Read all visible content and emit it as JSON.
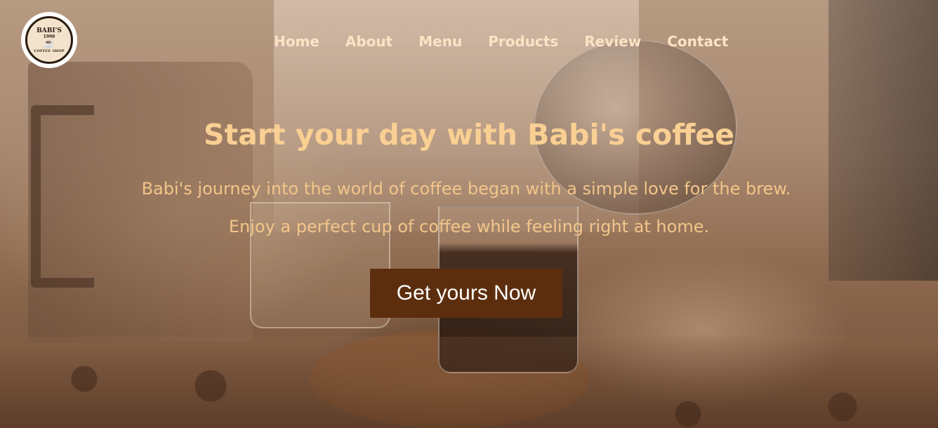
{
  "brand": {
    "logo_name": "BABI'S",
    "logo_year": "1990",
    "logo_shop": "COFFEE SHOP",
    "logo_icon": "coffee-cup-icon"
  },
  "nav": {
    "items": [
      {
        "label": "Home"
      },
      {
        "label": "About"
      },
      {
        "label": "Menu"
      },
      {
        "label": "Products"
      },
      {
        "label": "Review"
      },
      {
        "label": "Contact"
      }
    ]
  },
  "hero": {
    "title": "Start your day with Babi's coffee",
    "line1": "Babi's journey into the world of coffee began with a simple love for the brew.",
    "line2": "Enjoy a perfect cup of coffee while feeling right at home.",
    "cta_label": "Get yours Now"
  },
  "colors": {
    "nav_text": "#fde3c4",
    "title": "#f9cf93",
    "subtitle": "#f3c58a",
    "cta_bg": "#5c2e0e",
    "cta_text": "#ffffff"
  }
}
